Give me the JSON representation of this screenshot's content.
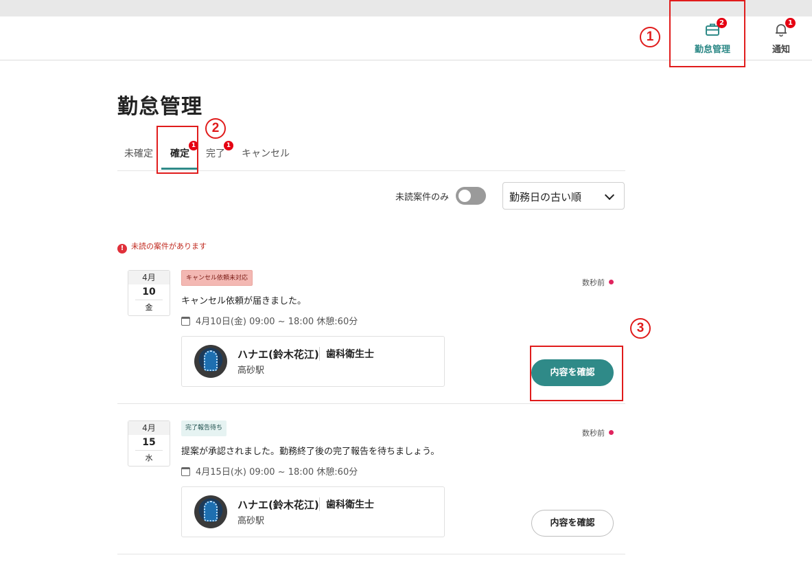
{
  "header": {
    "nav": [
      {
        "label": "勤怠管理",
        "badge": "2",
        "icon": "briefcase-icon"
      },
      {
        "label": "通知",
        "badge": "1",
        "icon": "bell-icon"
      }
    ]
  },
  "annotations": {
    "one": "1",
    "two": "2",
    "three": "3"
  },
  "page": {
    "title": "勤怠管理"
  },
  "tabs": [
    {
      "label": "未確定"
    },
    {
      "label": "確定",
      "badge": "1",
      "active": true
    },
    {
      "label": "完了",
      "badge": "1"
    },
    {
      "label": "キャンセル"
    }
  ],
  "filters": {
    "unread_only_label": "未読案件のみ",
    "unread_only_on": false,
    "sort_selected": "勤務日の古い順"
  },
  "notice": {
    "text": "未読の案件があります"
  },
  "cards": [
    {
      "date": {
        "month": "4月",
        "day": "10",
        "weekday": "金"
      },
      "tag": "キャンセル依頼未対応",
      "time_ago": "数秒前",
      "message": "キャンセル依頼が届きました。",
      "schedule": "4月10日(金) 09:00 ~ 18:00 休憩:60分",
      "worker": {
        "name": "ハナエ(鈴木花江)",
        "role": "歯科衛生士",
        "station": "高砂駅"
      },
      "button": "内容を確認"
    },
    {
      "date": {
        "month": "4月",
        "day": "15",
        "weekday": "水"
      },
      "tag": "完了報告待ち",
      "time_ago": "数秒前",
      "message": "提案が承認されました。勤務終了後の完了報告を待ちましょう。",
      "schedule": "4月15日(水) 09:00 ~ 18:00 休憩:60分",
      "worker": {
        "name": "ハナエ(鈴木花江)",
        "role": "歯科衛生士",
        "station": "高砂駅"
      },
      "button": "内容を確認"
    }
  ],
  "colors": {
    "accent": "#2f8a88",
    "badge": "#e50012",
    "annotation": "#e01b1b"
  }
}
